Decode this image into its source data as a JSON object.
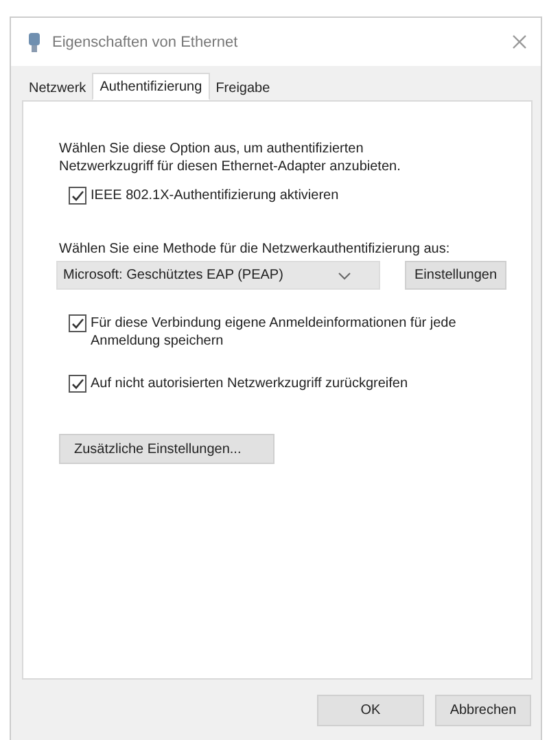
{
  "window": {
    "title": "Eigenschaften von Ethernet"
  },
  "tabs": [
    {
      "label": "Netzwerk",
      "selected": false
    },
    {
      "label": "Authentifizierung",
      "selected": true
    },
    {
      "label": "Freigabe",
      "selected": false
    }
  ],
  "description": "Wählen Sie diese Option aus, um authentifizierten Netzwerkzugriff für diesen Ethernet-Adapter anzubieten.",
  "enable_checkbox": {
    "label": "IEEE 802.1X-Authentifizierung aktivieren",
    "checked": true
  },
  "method_label": "Wählen Sie eine Methode für die Netzwerkauthentifizierung aus:",
  "method_dropdown": {
    "value": "Microsoft: Geschütztes EAP (PEAP)"
  },
  "settings_button": "Einstellungen",
  "options": [
    {
      "label": "Für diese Verbindung eigene Anmeldeinformationen für jede Anmeldung speichern",
      "checked": true
    },
    {
      "label": "Auf nicht autorisierten Netzwerkzugriff zurückgreifen",
      "checked": true
    }
  ],
  "additional_button": "Zusätzliche Einstellungen...",
  "buttons": [
    "OK",
    "Abbrechen"
  ]
}
